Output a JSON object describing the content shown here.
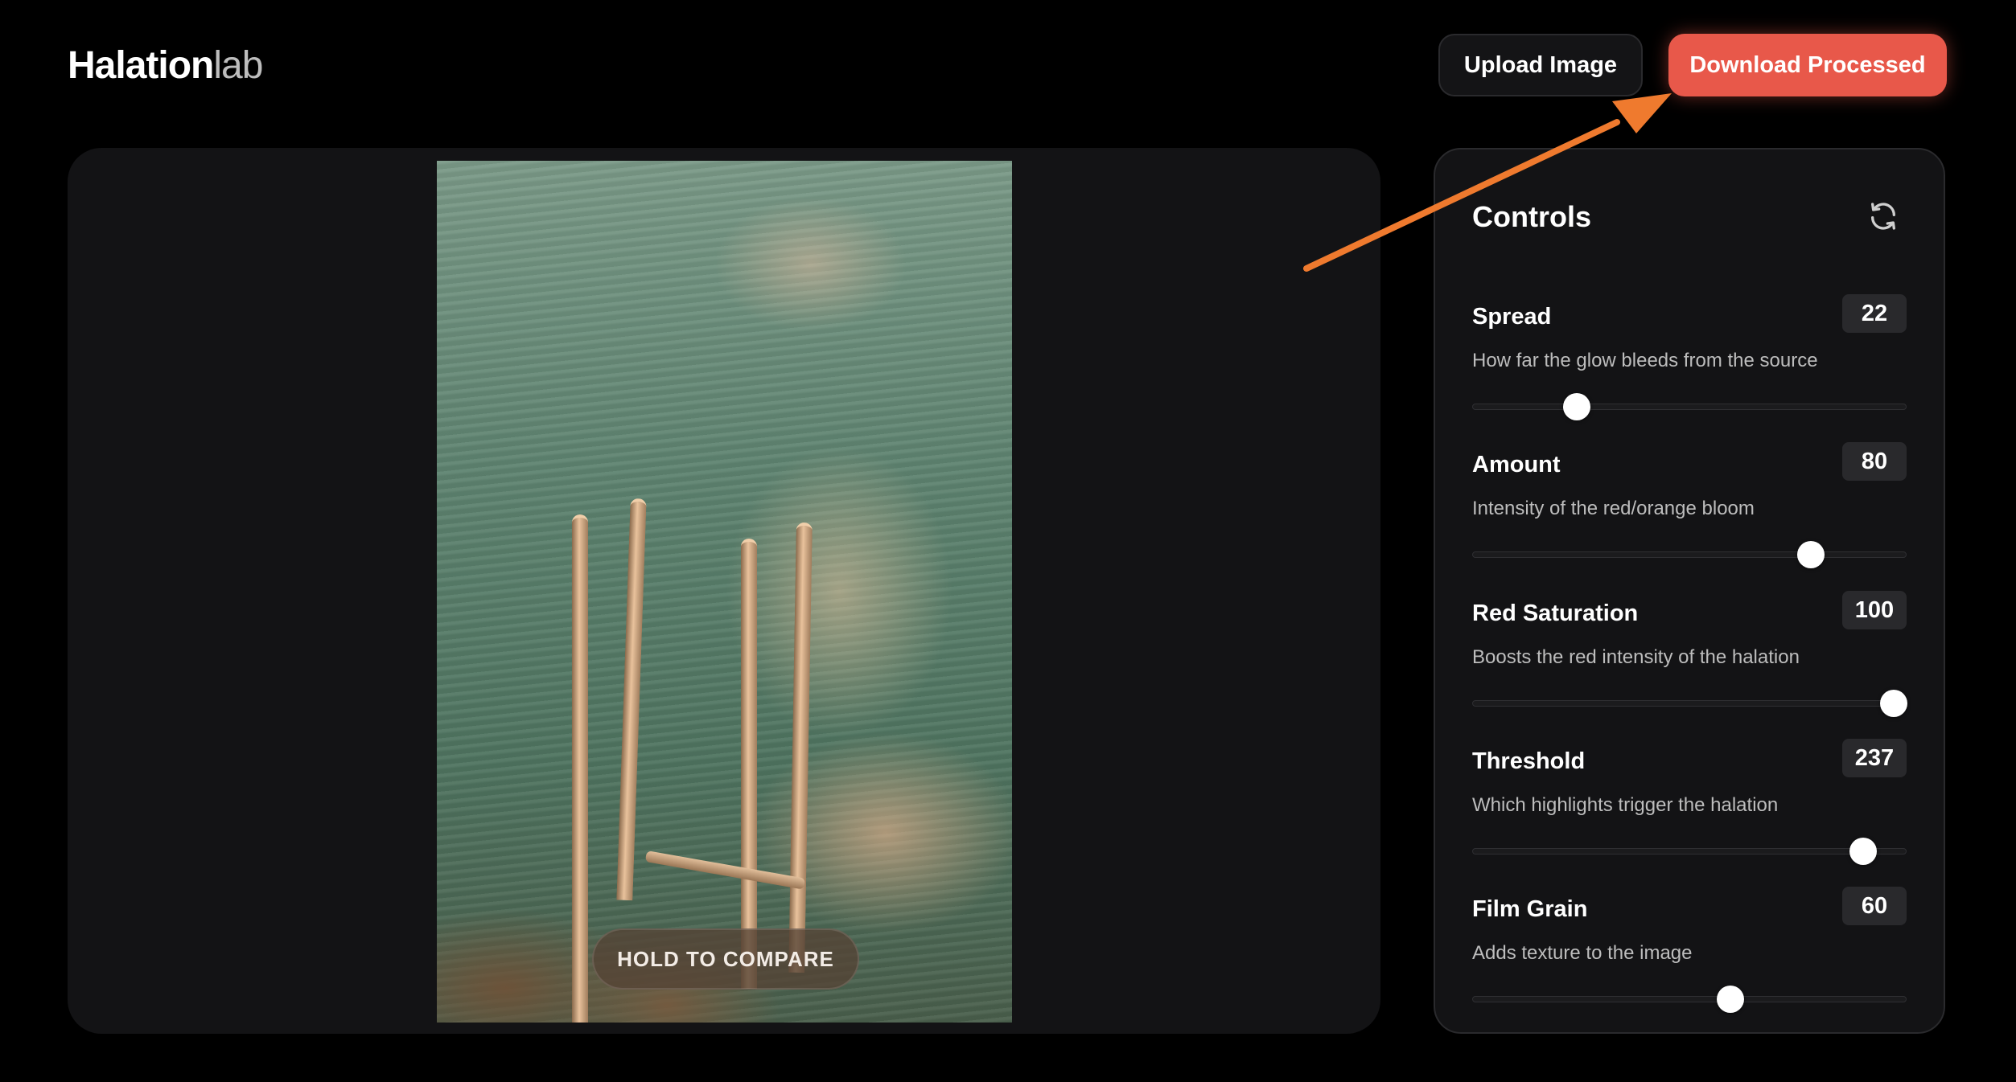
{
  "header": {
    "logo_bold": "Halation",
    "logo_light": "lab",
    "upload_label": "Upload Image",
    "download_label": "Download Processed"
  },
  "preview": {
    "compare_label": "HOLD TO COMPARE"
  },
  "controls": {
    "title": "Controls",
    "reset_icon": "refresh-icon",
    "items": [
      {
        "label": "Spread",
        "value": "22",
        "description": "How far the glow bleeds from the source",
        "fraction": 0.24
      },
      {
        "label": "Amount",
        "value": "80",
        "description": "Intensity of the red/orange bloom",
        "fraction": 0.78
      },
      {
        "label": "Red Saturation",
        "value": "100",
        "description": "Boosts the red intensity of the halation",
        "fraction": 0.97
      },
      {
        "label": "Threshold",
        "value": "237",
        "description": "Which highlights trigger the halation",
        "fraction": 0.9
      },
      {
        "label": "Film Grain",
        "value": "60",
        "description": "Adds texture to the image",
        "fraction": 0.595
      }
    ]
  },
  "colors": {
    "accent": "#e8584a",
    "annotation_arrow": "#ef7a2e",
    "panel": "#131315",
    "background": "#000000"
  }
}
